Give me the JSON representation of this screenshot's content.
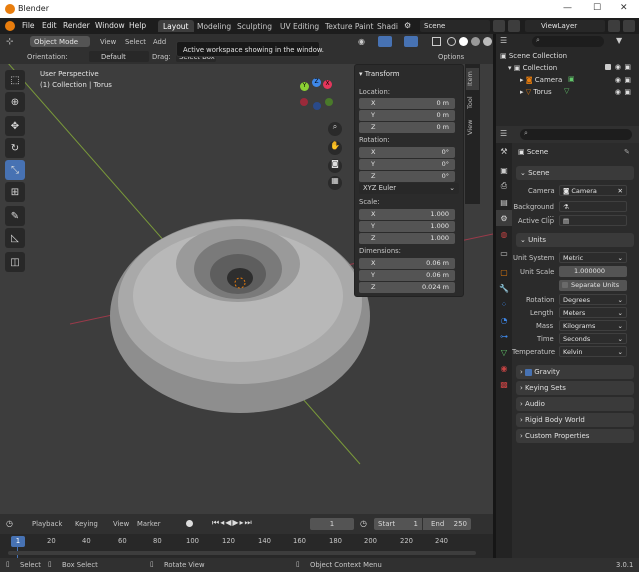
{
  "window": {
    "title": "Blender",
    "minimize": "—",
    "maximize": "☐",
    "close": "✕"
  },
  "menu": {
    "file": "File",
    "edit": "Edit",
    "render": "Render",
    "window": "Window",
    "help": "Help"
  },
  "workspaces": [
    "Layout",
    "Modeling",
    "Sculpting",
    "UV Editing",
    "Texture Paint",
    "Shadi"
  ],
  "scene_selector": "Scene",
  "view_layer": "ViewLayer",
  "header": {
    "mode": "Object Mode",
    "view": "View",
    "select": "Select",
    "add": "Add",
    "orientation_label": "Orientation:",
    "orientation_value": "Default",
    "drag_label": "Drag:",
    "drag_value": "Select Box",
    "options": "Options"
  },
  "tooltip": "Active workspace showing in the window.",
  "viewport": {
    "perspective": "User Perspective",
    "collection_info": "(1) Collection | Torus"
  },
  "gizmo": {
    "x": "X",
    "y": "Y",
    "z": "Z"
  },
  "npanel": {
    "title": "Transform",
    "tabs": [
      "Item",
      "Tool",
      "View"
    ],
    "location_label": "Location:",
    "location": [
      {
        "axis": "X",
        "value": "0 m"
      },
      {
        "axis": "Y",
        "value": "0 m"
      },
      {
        "axis": "Z",
        "value": "0 m"
      }
    ],
    "rotation_label": "Rotation:",
    "rotation": [
      {
        "axis": "X",
        "value": "0°"
      },
      {
        "axis": "Y",
        "value": "0°"
      },
      {
        "axis": "Z",
        "value": "0°"
      }
    ],
    "rotation_mode": "XYZ Euler",
    "scale_label": "Scale:",
    "scale": [
      {
        "axis": "X",
        "value": "1.000"
      },
      {
        "axis": "Y",
        "value": "1.000"
      },
      {
        "axis": "Z",
        "value": "1.000"
      }
    ],
    "dimensions_label": "Dimensions:",
    "dimensions": [
      {
        "axis": "X",
        "value": "0.06 m"
      },
      {
        "axis": "Y",
        "value": "0.06 m"
      },
      {
        "axis": "Z",
        "value": "0.024 m"
      }
    ]
  },
  "outliner": {
    "root": "Scene Collection",
    "collection": "Collection",
    "items": [
      "Camera",
      "Torus"
    ]
  },
  "properties": {
    "breadcrumb": "Scene",
    "scene_section": "Scene",
    "camera_label": "Camera",
    "camera_value": "Camera",
    "background_label": "Background ...",
    "active_clip_label": "Active Clip",
    "units_section": "Units",
    "unit_system_label": "Unit System",
    "unit_system_value": "Metric",
    "unit_scale_label": "Unit Scale",
    "unit_scale_value": "1.000000",
    "separate_units": "Separate Units",
    "rotation_label": "Rotation",
    "rotation_value": "Degrees",
    "length_label": "Length",
    "length_value": "Meters",
    "mass_label": "Mass",
    "mass_value": "Kilograms",
    "time_label": "Time",
    "time_value": "Seconds",
    "temperature_label": "Temperature",
    "temperature_value": "Kelvin",
    "collapsed_sections": [
      "Gravity",
      "Keying Sets",
      "Audio",
      "Rigid Body World",
      "Custom Properties"
    ]
  },
  "timeline": {
    "playback": "Playback",
    "keying": "Keying",
    "view": "View",
    "marker": "Marker",
    "current_frame": "1",
    "start_label": "Start",
    "start": "1",
    "end_label": "End",
    "end": "250",
    "ruler": [
      "1",
      "20",
      "40",
      "60",
      "80",
      "100",
      "120",
      "140",
      "160",
      "180",
      "200",
      "220",
      "240"
    ]
  },
  "status": {
    "select": "Select",
    "box_select": "Box Select",
    "rotate_view": "Rotate View",
    "context_menu": "Object Context Menu",
    "version": "3.0.1"
  },
  "colors": {
    "accent": "#4772b3",
    "x_axis": "#e4365c",
    "y_axis": "#8bd133",
    "z_axis": "#3e87e8",
    "orange": "#e87d0d"
  }
}
